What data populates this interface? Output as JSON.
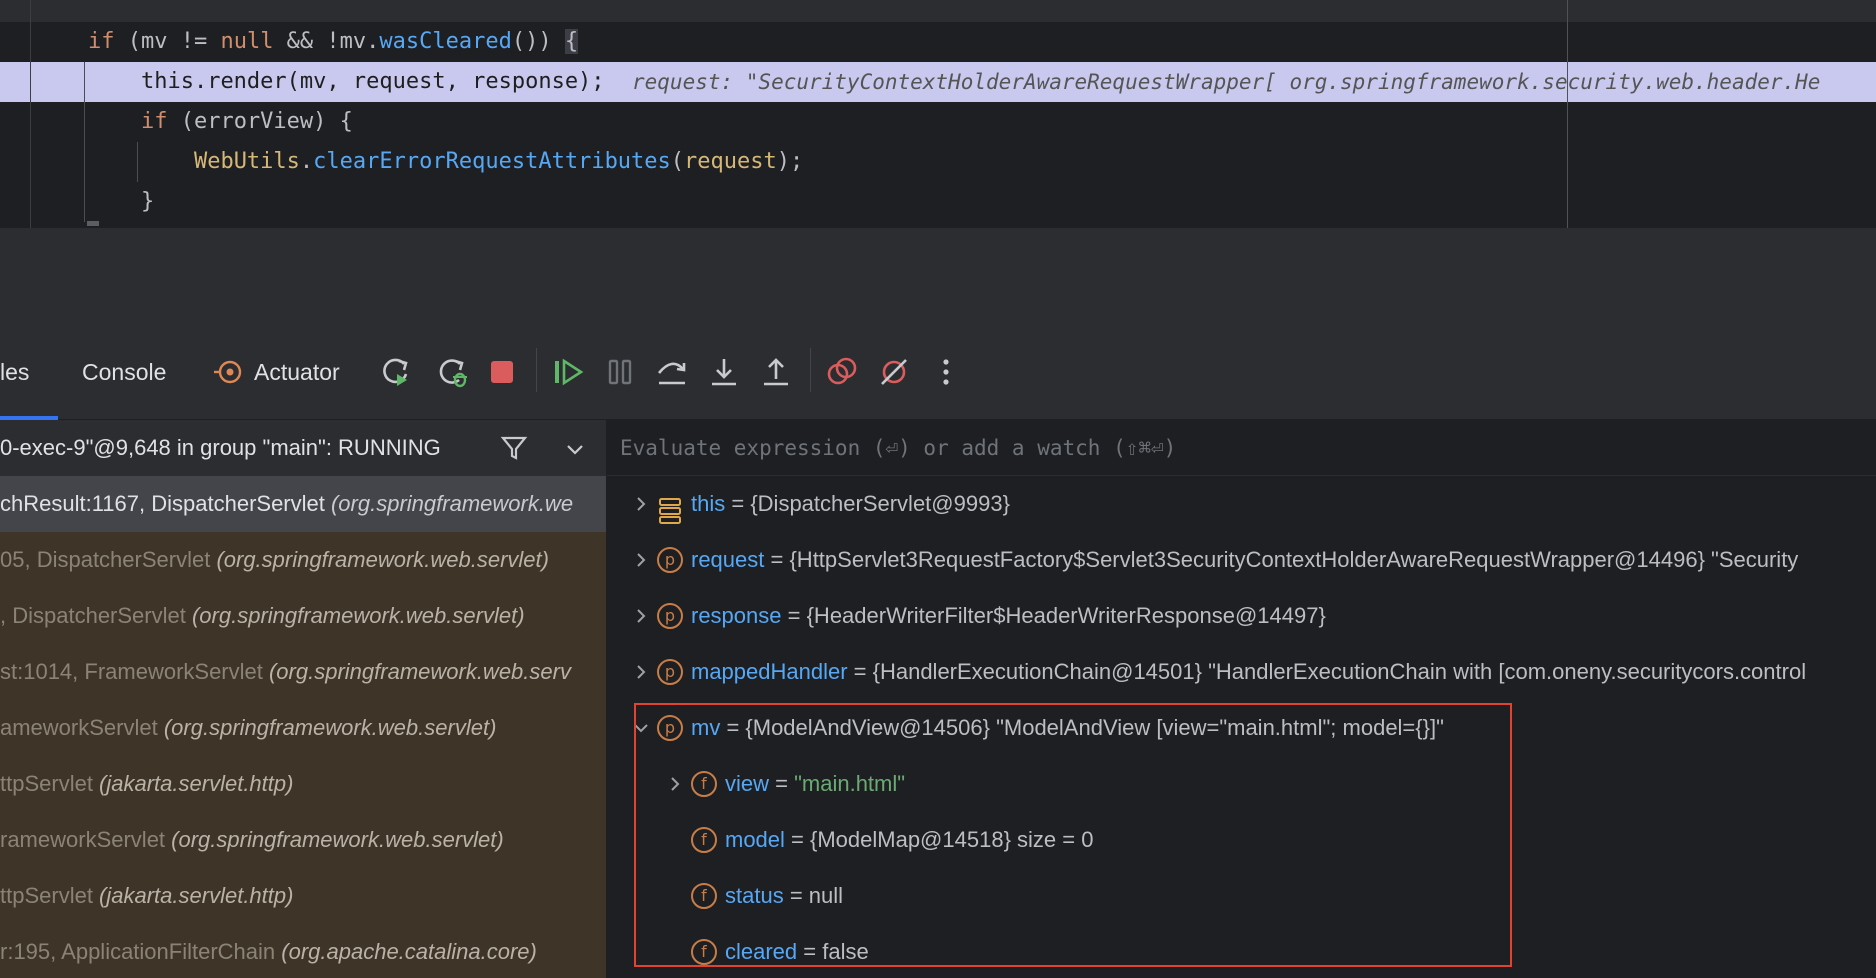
{
  "editor": {
    "lines": [
      {
        "indent": "    ",
        "parts": [
          {
            "t": "if",
            "c": "kw"
          },
          {
            "t": " (mv != "
          },
          {
            "t": "null",
            "c": "kw"
          },
          {
            "t": " && !mv."
          },
          {
            "t": "wasCleared",
            "c": "fn"
          },
          {
            "t": "()) "
          },
          {
            "t": "{",
            "c": "brace-mark"
          }
        ]
      },
      {
        "indent": "        ",
        "parts": [
          {
            "t": "this.render(mv, request, response);"
          }
        ]
      },
      {
        "indent": "        ",
        "parts": [
          {
            "t": "if",
            "c": "kw"
          },
          {
            "t": " (errorView) {"
          }
        ]
      },
      {
        "indent": "            ",
        "parts": [
          {
            "t": "WebUtils",
            "c": "cls"
          },
          {
            "t": "."
          },
          {
            "t": "clearErrorRequestAttributes",
            "c": "fn"
          },
          {
            "t": "("
          },
          {
            "t": "request",
            "c": "cls"
          },
          {
            "t": ");"
          }
        ]
      },
      {
        "indent": "        ",
        "parts": [
          {
            "t": "}"
          }
        ]
      }
    ],
    "inline_hint": "request: \"SecurityContextHolderAwareRequestWrapper[ org.springframework.security.web.header.He"
  },
  "toolbar": {
    "tab_frames": "les",
    "tab_console": "Console",
    "tab_actuator": "Actuator",
    "icons": [
      "rerun-icon",
      "rerun-debug-icon",
      "stop-icon",
      "resume-icon",
      "pause-icon",
      "step-over-icon",
      "step-into-icon",
      "step-out-icon",
      "view-breakpoints-icon",
      "mute-breakpoints-icon",
      "more-icon"
    ]
  },
  "frames": {
    "thread": "0-exec-9\"@9,648 in group \"main\": RUNNING",
    "rows": [
      {
        "method": "chResult:1167, DispatcherServlet ",
        "pkg": "(org.springframework.we",
        "selected": true
      },
      {
        "method": "05, DispatcherServlet ",
        "pkg": "(org.springframework.web.servlet)",
        "selected": false
      },
      {
        "method": ", DispatcherServlet ",
        "pkg": "(org.springframework.web.servlet)",
        "selected": false
      },
      {
        "method": "st:1014, FrameworkServlet ",
        "pkg": "(org.springframework.web.serv",
        "selected": false
      },
      {
        "method": "ameworkServlet ",
        "pkg": "(org.springframework.web.servlet)",
        "selected": false
      },
      {
        "method": "ttpServlet ",
        "pkg": "(jakarta.servlet.http)",
        "selected": false
      },
      {
        "method": "rameworkServlet ",
        "pkg": "(org.springframework.web.servlet)",
        "selected": false
      },
      {
        "method": "ttpServlet ",
        "pkg": "(jakarta.servlet.http)",
        "selected": false
      },
      {
        "method": "r:195, ApplicationFilterChain ",
        "pkg": "(org.apache.catalina.core)",
        "selected": false
      }
    ]
  },
  "variables": {
    "eval_placeholder": "Evaluate expression (⏎) or add a watch (⇧⌘⏎)",
    "rows": [
      {
        "name": "this",
        "badge": "",
        "value": " = {DispatcherServlet@9993}",
        "str": "",
        "expanded": false,
        "level": 0
      },
      {
        "name": "request",
        "badge": "p",
        "value": " = {HttpServlet3RequestFactory$Servlet3SecurityContextHolderAwareRequestWrapper@14496} \"Security",
        "str": "",
        "expanded": false,
        "level": 0
      },
      {
        "name": "response",
        "badge": "p",
        "value": " = {HeaderWriterFilter$HeaderWriterResponse@14497}",
        "str": "",
        "expanded": false,
        "level": 0
      },
      {
        "name": "mappedHandler",
        "badge": "p",
        "value": " = {HandlerExecutionChain@14501} \"HandlerExecutionChain with [com.oneny.securitycors.control",
        "str": "",
        "expanded": false,
        "level": 0
      },
      {
        "name": "mv",
        "badge": "p",
        "value": " = {ModelAndView@14506} \"ModelAndView [view=\"main.html\"; model={}]\"",
        "str": "",
        "expanded": true,
        "level": 0
      },
      {
        "name": "view",
        "badge": "f",
        "value": " = ",
        "str": "\"main.html\"",
        "expanded": false,
        "level": 1
      },
      {
        "name": "model",
        "badge": "f",
        "value": " = {ModelMap@14518}  size = 0",
        "str": "",
        "expanded": null,
        "level": 1
      },
      {
        "name": "status",
        "badge": "f",
        "value": " = null",
        "str": "",
        "expanded": null,
        "level": 1
      },
      {
        "name": "cleared",
        "badge": "f",
        "value": " = false",
        "str": "",
        "expanded": null,
        "level": 1
      }
    ]
  },
  "colors": {
    "highlight_line": "#c9c9f0",
    "frame_row_bg": "#3f3428",
    "annotation_box": "#e2432e",
    "var_name": "#56a8f5",
    "badge": "#c77d48"
  }
}
